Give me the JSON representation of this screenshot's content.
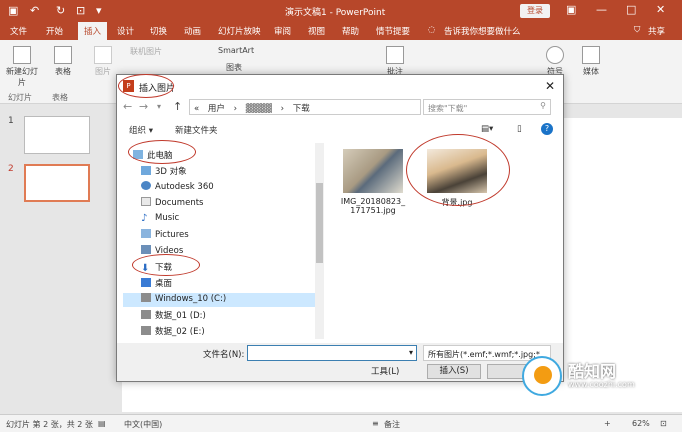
{
  "titlebar": {
    "title": "演示文稿1 - PowerPoint",
    "login": "登录"
  },
  "tabs": [
    "文件",
    "开始",
    "插入",
    "设计",
    "切换",
    "动画",
    "幻灯片放映",
    "审阅",
    "视图",
    "帮助",
    "情节提要"
  ],
  "active_tab": "插入",
  "tell_me": "告诉我你想要做什么",
  "share": "共享",
  "ribbon": {
    "new_slide": "新建幻灯片",
    "table": "表格",
    "picture": "图片",
    "online_pictures": "联机图片",
    "smartart": "SmartArt",
    "chart": "图表",
    "comment": "批注",
    "media": "媒体",
    "symbols": "符号",
    "group_slides": "幻灯片",
    "group_tables": "表格"
  },
  "slides": {
    "n1": "1",
    "n2": "2"
  },
  "dialog": {
    "title": "插入图片",
    "path": {
      "p1": "用户",
      "p2": "▓▓▓▓",
      "p3": "下载"
    },
    "search_placeholder": "搜索\"下载\"",
    "organize": "组织 ▾",
    "new_folder": "新建文件夹",
    "tree": {
      "pc": "此电脑",
      "objects3d": "3D 对象",
      "autodesk": "Autodesk 360",
      "documents": "Documents",
      "music": "Music",
      "pictures": "Pictures",
      "videos": "Videos",
      "downloads": "下载",
      "desktop": "桌面",
      "win": "Windows_10 (C:)",
      "d1": "数据_01 (D:)",
      "d2": "数据_02 (E:)"
    },
    "files": {
      "f1a": "IMG_20180823_",
      "f1b": "171751.jpg",
      "f2": "背景.jpg"
    },
    "filename_label": "文件名(N):",
    "filter": "所有图片(*.emf;*.wmf;*.jpg;*",
    "tools": "工具(L)",
    "insert": "插入(S)"
  },
  "status": {
    "slide": "幻灯片 第 2 张，共 2 张",
    "lang": "中文(中国)",
    "notes": "备注",
    "zoom": "62%"
  },
  "watermark": {
    "brand": "酷知网",
    "url": "www.coozhi.com"
  },
  "colors": {
    "accent": "#b7472a",
    "highlight": "#cce8ff"
  }
}
